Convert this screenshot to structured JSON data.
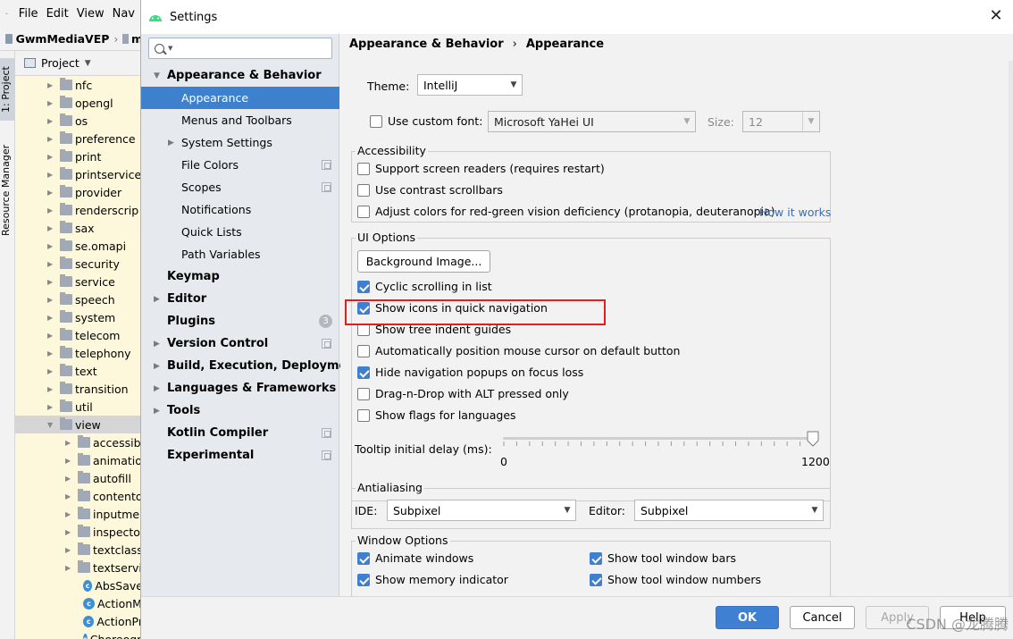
{
  "ide": {
    "menus": [
      "File",
      "Edit",
      "View",
      "Nav"
    ],
    "crumb_project": "GwmMediaVEP",
    "crumb_next": "m",
    "stripe_project": "1: Project",
    "stripe_resource": "Resource Manager",
    "project_view_label": "Project",
    "tree": [
      {
        "label": "nfc",
        "kind": "folder",
        "indent": 0
      },
      {
        "label": "opengl",
        "kind": "folder",
        "indent": 0
      },
      {
        "label": "os",
        "kind": "folder",
        "indent": 0
      },
      {
        "label": "preference",
        "kind": "folder",
        "indent": 0
      },
      {
        "label": "print",
        "kind": "folder",
        "indent": 0
      },
      {
        "label": "printservice",
        "kind": "folder",
        "indent": 0
      },
      {
        "label": "provider",
        "kind": "folder",
        "indent": 0
      },
      {
        "label": "renderscrip",
        "kind": "folder",
        "indent": 0
      },
      {
        "label": "sax",
        "kind": "folder",
        "indent": 0
      },
      {
        "label": "se.omapi",
        "kind": "folder",
        "indent": 0
      },
      {
        "label": "security",
        "kind": "folder",
        "indent": 0
      },
      {
        "label": "service",
        "kind": "folder",
        "indent": 0
      },
      {
        "label": "speech",
        "kind": "folder",
        "indent": 0
      },
      {
        "label": "system",
        "kind": "folder",
        "indent": 0
      },
      {
        "label": "telecom",
        "kind": "folder",
        "indent": 0
      },
      {
        "label": "telephony",
        "kind": "folder",
        "indent": 0
      },
      {
        "label": "text",
        "kind": "folder",
        "indent": 0
      },
      {
        "label": "transition",
        "kind": "folder",
        "indent": 0
      },
      {
        "label": "util",
        "kind": "folder",
        "indent": 0
      },
      {
        "label": "view",
        "kind": "folder-open",
        "indent": 0,
        "selected": true
      },
      {
        "label": "accessib",
        "kind": "folder",
        "indent": 1
      },
      {
        "label": "animatio",
        "kind": "folder",
        "indent": 1
      },
      {
        "label": "autofill",
        "kind": "folder",
        "indent": 1
      },
      {
        "label": "contento",
        "kind": "folder",
        "indent": 1
      },
      {
        "label": "inputme",
        "kind": "folder",
        "indent": 1
      },
      {
        "label": "inspecto",
        "kind": "folder",
        "indent": 1
      },
      {
        "label": "textclass",
        "kind": "folder",
        "indent": 1
      },
      {
        "label": "textservi",
        "kind": "folder",
        "indent": 1
      },
      {
        "label": "AbsSave",
        "kind": "class",
        "indent": 1
      },
      {
        "label": "ActionM",
        "kind": "class",
        "indent": 1
      },
      {
        "label": "ActionPr",
        "kind": "class",
        "indent": 1
      },
      {
        "label": "Choreographer",
        "kind": "class",
        "indent": 1
      }
    ]
  },
  "dialog": {
    "title": "Settings",
    "search_placeholder": "",
    "nav": [
      {
        "label": "Appearance & Behavior",
        "bold": true,
        "arrow": "down",
        "level": 0
      },
      {
        "label": "Appearance",
        "level": 1,
        "selected": true
      },
      {
        "label": "Menus and Toolbars",
        "level": 1
      },
      {
        "label": "System Settings",
        "level": 1,
        "arrow": "right"
      },
      {
        "label": "File Colors",
        "level": 1,
        "copy": true
      },
      {
        "label": "Scopes",
        "level": 1,
        "copy": true
      },
      {
        "label": "Notifications",
        "level": 1
      },
      {
        "label": "Quick Lists",
        "level": 1
      },
      {
        "label": "Path Variables",
        "level": 1
      },
      {
        "label": "Keymap",
        "bold": true,
        "level": 0
      },
      {
        "label": "Editor",
        "bold": true,
        "arrow": "right",
        "level": 0
      },
      {
        "label": "Plugins",
        "bold": true,
        "level": 0,
        "badge": "3"
      },
      {
        "label": "Version Control",
        "bold": true,
        "arrow": "right",
        "level": 0,
        "copy": true
      },
      {
        "label": "Build, Execution, Deployment",
        "bold": true,
        "arrow": "right",
        "level": 0
      },
      {
        "label": "Languages & Frameworks",
        "bold": true,
        "arrow": "right",
        "level": 0
      },
      {
        "label": "Tools",
        "bold": true,
        "arrow": "right",
        "level": 0
      },
      {
        "label": "Kotlin Compiler",
        "bold": true,
        "level": 0,
        "copy": true
      },
      {
        "label": "Experimental",
        "bold": true,
        "level": 0,
        "copy": true
      }
    ],
    "header": {
      "parent": "Appearance & Behavior",
      "sep": "›",
      "current": "Appearance"
    },
    "theme": {
      "label": "Theme:",
      "value": "IntelliJ"
    },
    "custom_font": {
      "label": "Use custom font:",
      "checked": false,
      "font_value": "Microsoft YaHei UI",
      "size_label": "Size:",
      "size_value": "12"
    },
    "accessibility": {
      "title": "Accessibility",
      "items": [
        {
          "label": "Support screen readers (requires restart)",
          "checked": false
        },
        {
          "label": "Use contrast scrollbars",
          "checked": false
        },
        {
          "label": "Adjust colors for red-green vision deficiency (protanopia, deuteranopia)",
          "checked": false
        }
      ],
      "link": "How it works"
    },
    "ui_options": {
      "title": "UI Options",
      "bg_button": "Background Image...",
      "items": [
        {
          "label": "Cyclic scrolling in list",
          "checked": true
        },
        {
          "label": "Show icons in quick navigation",
          "checked": true
        },
        {
          "label": "Show tree indent guides",
          "checked": false
        },
        {
          "label": "Automatically position mouse cursor on default button",
          "checked": false
        },
        {
          "label": "Hide navigation popups on focus loss",
          "checked": true
        },
        {
          "label": "Drag-n-Drop with ALT pressed only",
          "checked": false
        },
        {
          "label": "Show flags for languages",
          "checked": false
        }
      ],
      "tooltip_label": "Tooltip initial delay (ms):",
      "slider_min": "0",
      "slider_max": "1200",
      "slider_value": 1200
    },
    "antialiasing": {
      "title": "Antialiasing",
      "ide_label": "IDE:",
      "ide_value": "Subpixel",
      "editor_label": "Editor:",
      "editor_value": "Subpixel"
    },
    "window_options": {
      "title": "Window Options",
      "left": [
        {
          "label": "Animate windows",
          "checked": true
        },
        {
          "label": "Show memory indicator",
          "checked": true
        }
      ],
      "right": [
        {
          "label": "Show tool window bars",
          "checked": true
        },
        {
          "label": "Show tool window numbers",
          "checked": true
        }
      ]
    },
    "buttons": {
      "ok": "OK",
      "cancel": "Cancel",
      "apply": "Apply",
      "help": "Help"
    },
    "watermark": "CSDN @龙腾腾",
    "colors": {
      "accent": "#3d80cd",
      "highlight": "#e02020",
      "link": "#2f6fc4"
    }
  }
}
